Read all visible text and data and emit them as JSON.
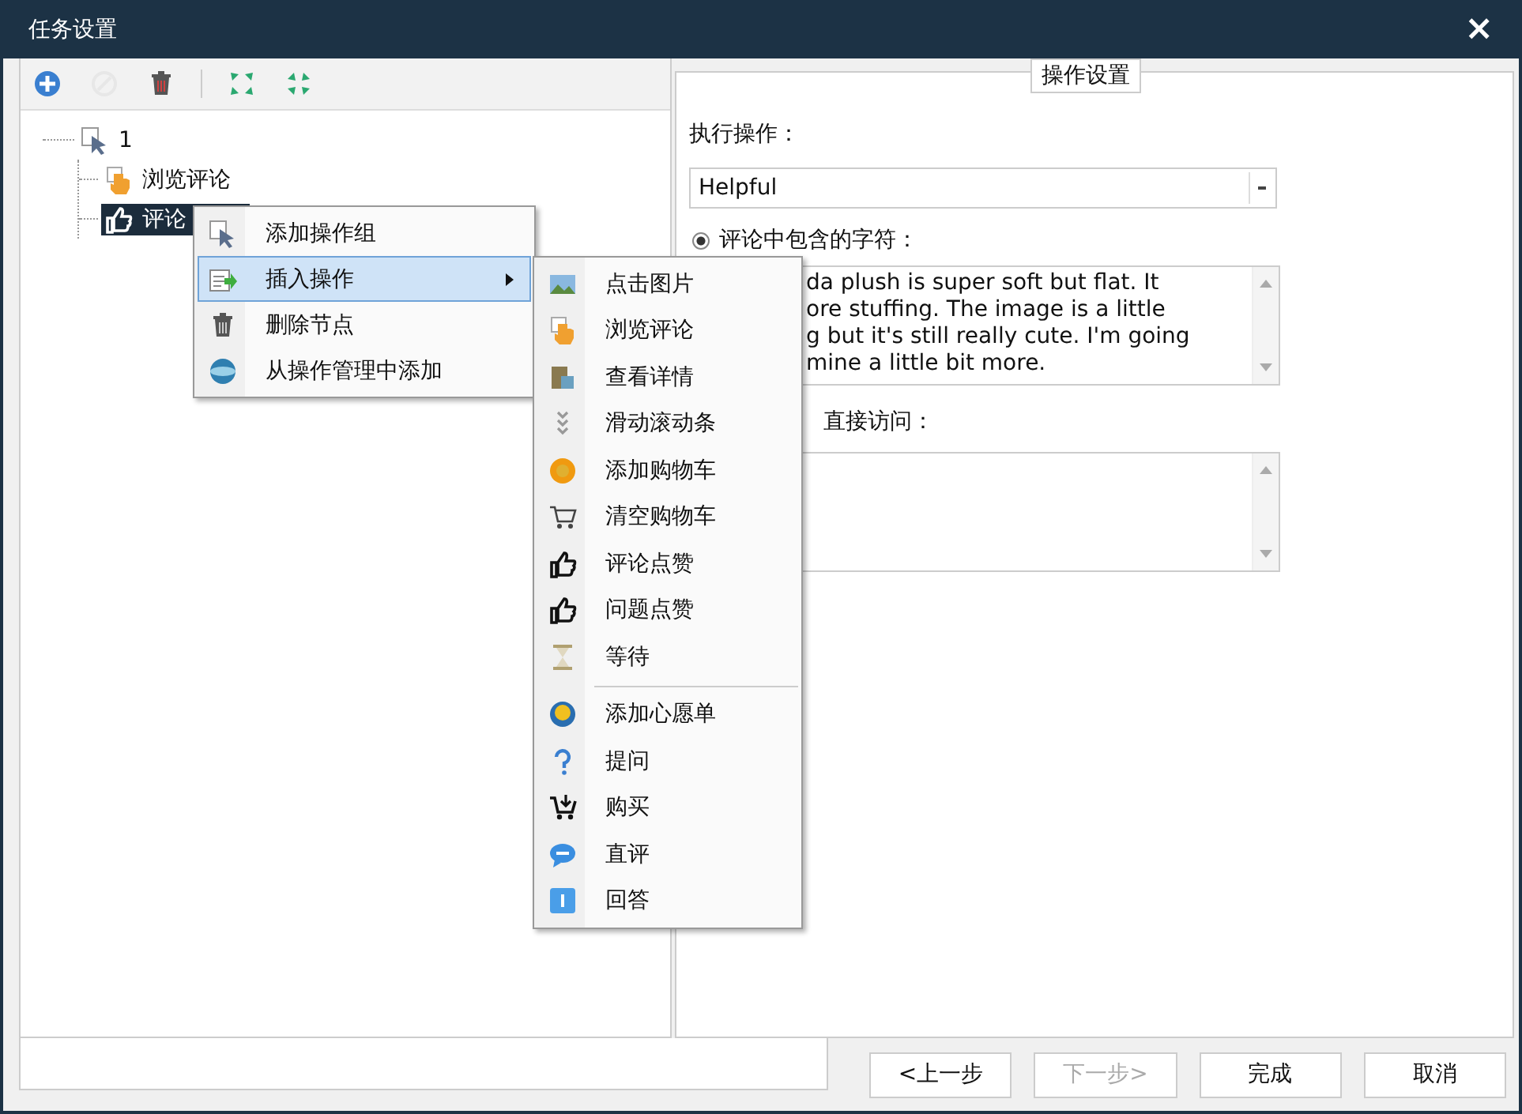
{
  "window": {
    "title": "任务设置",
    "close": "×"
  },
  "toolbar": [
    {
      "disabled": false
    },
    {
      "disabled": true
    },
    {
      "disabled": false
    },
    {
      "disabled": false
    },
    {
      "disabled": false
    }
  ],
  "tree": [
    {
      "label": "1",
      "selected": false,
      "expanded": true,
      "children": [
        {
          "label": "浏览评论",
          "selected": false
        },
        {
          "label": "评论",
          "selected": true
        }
      ]
    }
  ],
  "context_menu": {
    "items": [
      {
        "kind": "item",
        "label": "添加操作组",
        "selected": false,
        "submenu": false
      },
      {
        "kind": "item",
        "label": "插入操作",
        "selected": true,
        "submenu": true
      },
      {
        "kind": "item",
        "label": "删除节点",
        "selected": false,
        "submenu": false
      },
      {
        "kind": "item",
        "label": "从操作管理中添加",
        "selected": false,
        "submenu": false
      }
    ]
  },
  "submenu": {
    "items": [
      {
        "kind": "item",
        "label": "点击图片"
      },
      {
        "kind": "item",
        "label": "浏览评论"
      },
      {
        "kind": "item",
        "label": "查看详情"
      },
      {
        "kind": "item",
        "label": "滑动滚动条"
      },
      {
        "kind": "item",
        "label": "添加购物车"
      },
      {
        "kind": "item",
        "label": "清空购物车"
      },
      {
        "kind": "item",
        "label": "评论点赞"
      },
      {
        "kind": "item",
        "label": "问题点赞"
      },
      {
        "kind": "item",
        "label": "等待"
      },
      {
        "kind": "separator"
      },
      {
        "kind": "item",
        "label": "添加心愿单"
      },
      {
        "kind": "item",
        "label": "提问"
      },
      {
        "kind": "item",
        "label": "购买"
      },
      {
        "kind": "item",
        "label": "直评"
      },
      {
        "kind": "item",
        "label": "回答"
      }
    ]
  },
  "settings": {
    "legend": "操作设置",
    "action_label": "执行操作：",
    "action_value": "Helpful",
    "radio": {
      "label": "评论中包含的字符：",
      "selected": true
    },
    "text_lines": [
      "da plush is super soft but flat. It",
      "ore stuffing. The image is a little",
      "g but it's still really cute. I'm going",
      "mine a little bit more."
    ],
    "link_label": "直接访问："
  },
  "buttons": [
    {
      "label": "<上一步",
      "disabled": false
    },
    {
      "label": "下一步>",
      "disabled": true
    },
    {
      "label": "完成",
      "disabled": false
    },
    {
      "label": "取消",
      "disabled": false
    }
  ]
}
